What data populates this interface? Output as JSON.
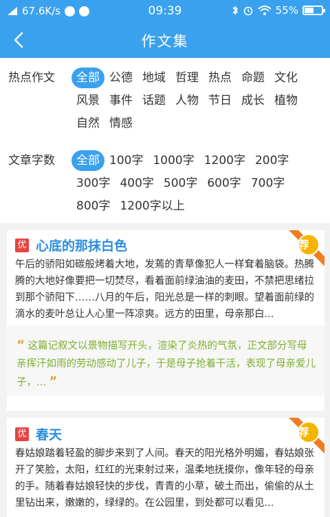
{
  "status": {
    "speed": "67.6K/s",
    "time": "09:39",
    "battery": "55%",
    "battery_level": 0.55
  },
  "header": {
    "title": "作文集",
    "back_icon": "chevron-left-icon"
  },
  "filters": {
    "hot_label": "热点作文",
    "hot_options": [
      "全部",
      "公德",
      "地域",
      "哲理",
      "热点",
      "命题",
      "文化",
      "风景",
      "事件",
      "话题",
      "人物",
      "节日",
      "成长",
      "植物",
      "自然",
      "情感"
    ],
    "count_label": "文章字数",
    "count_options": [
      "全部",
      "100字",
      "1000字",
      "1200字",
      "200字",
      "300字",
      "400字",
      "500字",
      "600字",
      "700字",
      "800字",
      "1200字以上"
    ]
  },
  "articles": [
    {
      "badge": "优",
      "title": "心底的那抹白色",
      "recommend": "荐",
      "excerpt": "午后的骄阳如碳般烤着大地，发蔫的青草像犯人一样耷着脑袋。热腾腾的大地好像要把一切焚尽，看着面前绿油油的麦田，不禁把思绪拉到那个骄阳下……八月的午后，阳光总是一样的刺眼。望着面前绿的滴水的麦叶总让人心里一阵凉爽。远方的田里，母亲那白...",
      "comment": "这篇记叙文以景物描写开头，渲染了炎热的气氛，正文部分写母亲挥汗如雨的劳动感动了儿子，于是母子抢着干活，表现了母亲爱儿子，..."
    },
    {
      "badge": "优",
      "title": "春天",
      "recommend": "荐",
      "excerpt": "春姑娘踏着轻盈的脚步来到了人间。春天的阳光格外明媚，春姑娘张开了笑脸，太阳，红红的光束射过来，温柔地抚摸你，像年轻的母亲的手。随着春姑娘轻快的步伐，青青的小草，破土而出，偷偷的从土里钻出来，嫩嫩的，绿绿的。在公园里，到处都可以看见..."
    }
  ],
  "colors": {
    "primary": "#3aa1ee",
    "title_blue": "#2b8de0",
    "badge_red": "#e64340",
    "comment_green": "#7fae2f",
    "ribbon_orange": "#f07d1e",
    "medal_gold": "#f5b400"
  }
}
